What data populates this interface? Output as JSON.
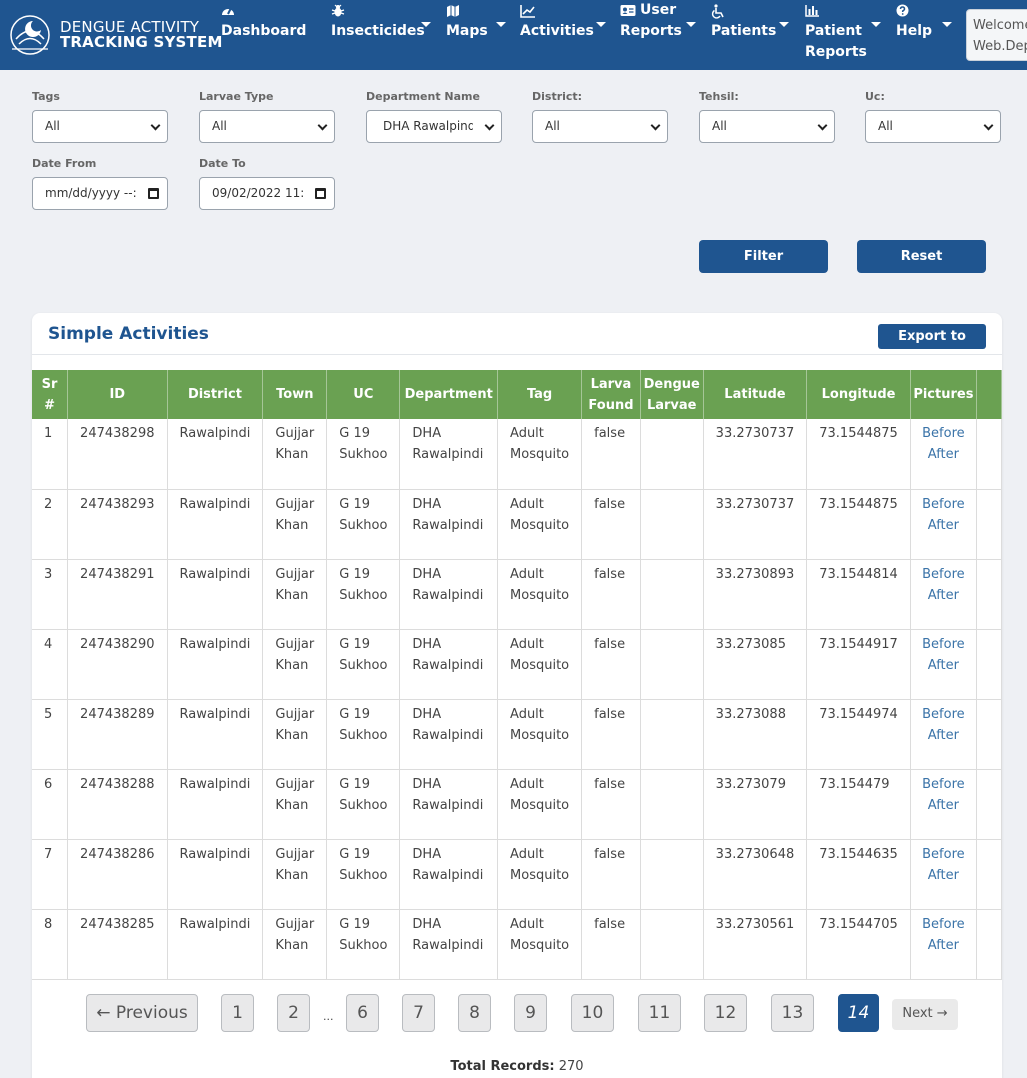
{
  "header": {
    "brand_line1": "DENGUE ACTIVITY",
    "brand_line2": "TRACKING SYSTEM",
    "nav": [
      {
        "label": "Dashboard",
        "icon": "dashboard-gauge-icon"
      },
      {
        "label": "Insecticides",
        "icon": "bug-icon"
      },
      {
        "label": "Maps",
        "icon": "map-icon"
      },
      {
        "label": "Activities",
        "icon": "chart-line-icon"
      },
      {
        "label_line1": "User",
        "label_line2": "Reports",
        "icon": "id-card-icon"
      },
      {
        "label": "Patients",
        "icon": "wheelchair-icon"
      },
      {
        "label_line1": "Patient",
        "label_line2": "Reports",
        "icon": "bar-chart-icon"
      },
      {
        "label": "Help",
        "icon": "question-circle-icon"
      }
    ],
    "welcome_line1": "Welcome",
    "welcome_line2": "Web.Dep"
  },
  "filters": {
    "tags": {
      "label": "Tags",
      "value": "All"
    },
    "larvae_type": {
      "label": "Larvae Type",
      "value": "All"
    },
    "department": {
      "label": "Department Name",
      "value": "DHA Rawalpindi"
    },
    "district": {
      "label": "District:",
      "value": "All"
    },
    "tehsil": {
      "label": "Tehsil:",
      "value": "All"
    },
    "uc": {
      "label": "Uc:",
      "value": "All"
    },
    "date_from": {
      "label": "Date From",
      "value": "mm/dd/yyyy --:"
    },
    "date_to": {
      "label": "Date To",
      "value": "09/02/2022 11:"
    },
    "filter_btn": "Filter",
    "reset_btn": "Reset"
  },
  "table": {
    "title": "Simple Activities",
    "export_label": "Export to Excel",
    "headers": [
      [
        "Sr",
        "#"
      ],
      [
        "ID"
      ],
      [
        "District"
      ],
      [
        "Town"
      ],
      [
        "UC"
      ],
      [
        "Department"
      ],
      [
        "Tag"
      ],
      [
        "Larva",
        "Found"
      ],
      [
        "Dengue",
        "Larvae"
      ],
      [
        "Latitude"
      ],
      [
        "Longitude"
      ],
      [
        "Pictures"
      ]
    ],
    "rows": [
      {
        "sr": "1",
        "id": "247438298",
        "district": "Rawalpindi",
        "town": [
          "Gujjar",
          "Khan"
        ],
        "uc": [
          "G 19",
          "Sukhoo"
        ],
        "department": [
          "DHA",
          "Rawalpindi"
        ],
        "tag": [
          "Adult",
          "Mosquito"
        ],
        "larva_found": "false",
        "dengue_larvae": "",
        "lat": "33.2730737",
        "lng": "73.1544875",
        "before": "Before",
        "after": "After"
      },
      {
        "sr": "2",
        "id": "247438293",
        "district": "Rawalpindi",
        "town": [
          "Gujjar",
          "Khan"
        ],
        "uc": [
          "G 19",
          "Sukhoo"
        ],
        "department": [
          "DHA",
          "Rawalpindi"
        ],
        "tag": [
          "Adult",
          "Mosquito"
        ],
        "larva_found": "false",
        "dengue_larvae": "",
        "lat": "33.2730737",
        "lng": "73.1544875",
        "before": "Before",
        "after": "After"
      },
      {
        "sr": "3",
        "id": "247438291",
        "district": "Rawalpindi",
        "town": [
          "Gujjar",
          "Khan"
        ],
        "uc": [
          "G 19",
          "Sukhoo"
        ],
        "department": [
          "DHA",
          "Rawalpindi"
        ],
        "tag": [
          "Adult",
          "Mosquito"
        ],
        "larva_found": "false",
        "dengue_larvae": "",
        "lat": "33.2730893",
        "lng": "73.1544814",
        "before": "Before",
        "after": "After"
      },
      {
        "sr": "4",
        "id": "247438290",
        "district": "Rawalpindi",
        "town": [
          "Gujjar",
          "Khan"
        ],
        "uc": [
          "G 19",
          "Sukhoo"
        ],
        "department": [
          "DHA",
          "Rawalpindi"
        ],
        "tag": [
          "Adult",
          "Mosquito"
        ],
        "larva_found": "false",
        "dengue_larvae": "",
        "lat": "33.273085",
        "lng": "73.1544917",
        "before": "Before",
        "after": "After"
      },
      {
        "sr": "5",
        "id": "247438289",
        "district": "Rawalpindi",
        "town": [
          "Gujjar",
          "Khan"
        ],
        "uc": [
          "G 19",
          "Sukhoo"
        ],
        "department": [
          "DHA",
          "Rawalpindi"
        ],
        "tag": [
          "Adult",
          "Mosquito"
        ],
        "larva_found": "false",
        "dengue_larvae": "",
        "lat": "33.273088",
        "lng": "73.1544974",
        "before": "Before",
        "after": "After"
      },
      {
        "sr": "6",
        "id": "247438288",
        "district": "Rawalpindi",
        "town": [
          "Gujjar",
          "Khan"
        ],
        "uc": [
          "G 19",
          "Sukhoo"
        ],
        "department": [
          "DHA",
          "Rawalpindi"
        ],
        "tag": [
          "Adult",
          "Mosquito"
        ],
        "larva_found": "false",
        "dengue_larvae": "",
        "lat": "33.273079",
        "lng": "73.154479",
        "before": "Before",
        "after": "After"
      },
      {
        "sr": "7",
        "id": "247438286",
        "district": "Rawalpindi",
        "town": [
          "Gujjar",
          "Khan"
        ],
        "uc": [
          "G 19",
          "Sukhoo"
        ],
        "department": [
          "DHA",
          "Rawalpindi"
        ],
        "tag": [
          "Adult",
          "Mosquito"
        ],
        "larva_found": "false",
        "dengue_larvae": "",
        "lat": "33.2730648",
        "lng": "73.1544635",
        "before": "Before",
        "after": "After"
      },
      {
        "sr": "8",
        "id": "247438285",
        "district": "Rawalpindi",
        "town": [
          "Gujjar",
          "Khan"
        ],
        "uc": [
          "G 19",
          "Sukhoo"
        ],
        "department": [
          "DHA",
          "Rawalpindi"
        ],
        "tag": [
          "Adult",
          "Mosquito"
        ],
        "larva_found": "false",
        "dengue_larvae": "",
        "lat": "33.2730561",
        "lng": "73.1544705",
        "before": "Before",
        "after": "After"
      }
    ]
  },
  "pagination": {
    "previous": "← Previous",
    "pages": [
      "1",
      "2",
      "6",
      "7",
      "8",
      "9",
      "10",
      "11",
      "12",
      "13",
      "14"
    ],
    "ellipsis": "...",
    "active": "14",
    "next": "Next →",
    "total_label": "Total Records:",
    "total_value": "270"
  },
  "colors": {
    "brand": "#1f5590",
    "table_header": "#6aa152",
    "link": "#3a73a8"
  }
}
